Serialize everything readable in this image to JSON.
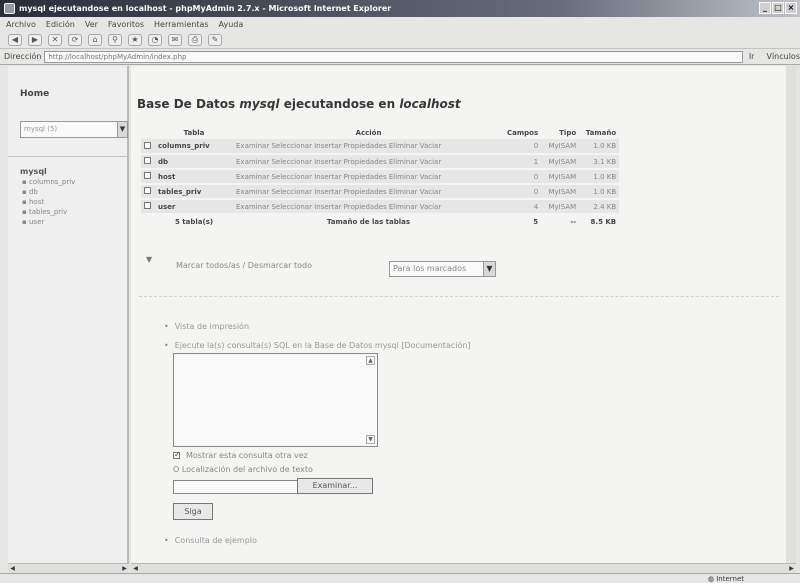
{
  "window": {
    "title": "mysql ejecutandose en localhost - phpMyAdmin 2.7.x - Microsoft Internet Explorer",
    "controls": [
      "_",
      "□",
      "×"
    ]
  },
  "menu": [
    "Archivo",
    "Edición",
    "Ver",
    "Favoritos",
    "Herramientas",
    "Ayuda"
  ],
  "toolbar": [
    "◀",
    "▶",
    "✕",
    "⟳",
    "⌂",
    "⚲",
    "★",
    "◔",
    "✉",
    "⎙",
    "✎"
  ],
  "address": {
    "label": "Dirección",
    "url": "http://localhost/phpMyAdmin/index.php",
    "go": "Ir",
    "links": "Vínculos"
  },
  "left": {
    "home": "Home",
    "db_select": "mysql (5)",
    "db_name": "mysql",
    "tables": [
      "columns_priv",
      "db",
      "host",
      "tables_priv",
      "user"
    ]
  },
  "main": {
    "title_prefix": "Base De Datos",
    "title_db": "mysql",
    "title_mid": "ejecutandose en",
    "title_host": "localhost",
    "columns": [
      "Tabla",
      "Acción",
      "Campos",
      "Tipo",
      "Tamaño"
    ],
    "actions": "Examinar Seleccionar Insertar Propiedades Eliminar Vaciar",
    "rows": [
      {
        "table": "columns_priv",
        "fields": "0",
        "type": "MyISAM",
        "size": "1.0 KB"
      },
      {
        "table": "db",
        "fields": "1",
        "type": "MyISAM",
        "size": "3.1 KB"
      },
      {
        "table": "host",
        "fields": "0",
        "type": "MyISAM",
        "size": "1.0 KB"
      },
      {
        "table": "tables_priv",
        "fields": "0",
        "type": "MyISAM",
        "size": "1.0 KB"
      },
      {
        "table": "user",
        "fields": "4",
        "type": "MyISAM",
        "size": "2.4 KB"
      }
    ],
    "sum_label": "5 tabla(s)",
    "sum_desc": "Tamaño de las tablas",
    "sum_fields": "5",
    "sum_type": "--",
    "sum_size": "8.5 KB",
    "mark_all": "Marcar todos/as / Desmarcar todo",
    "with_selected": "Para los marcados",
    "print_view": "Vista de impresión",
    "sql_label": "Ejecute la(s) consulta(s) SQL en la Base de Datos mysql [Documentación]",
    "show_query": "Mostrar esta consulta otra vez",
    "file_label": "O Localización del archivo de texto",
    "browse": "Examinar...",
    "go": "Siga",
    "example_query": "Consulta de ejemplo"
  },
  "status": {
    "zone": "Internet"
  }
}
